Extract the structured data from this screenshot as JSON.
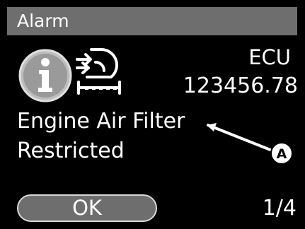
{
  "header": {
    "title": "Alarm"
  },
  "status": {
    "info_icon": "info-icon",
    "alarm_icon": "engine-air-filter-icon",
    "source_label": "ECU",
    "source_value": "123456.78"
  },
  "message": {
    "line1": "Engine Air Filter",
    "line2": "Restricted"
  },
  "annotation": {
    "callout_label": "A"
  },
  "footer": {
    "ok_label": "OK",
    "page_indicator": "1/4"
  },
  "colors": {
    "background": "#000000",
    "titlebar": "#6e6e6e",
    "button": "#6e6e6e",
    "text": "#ffffff"
  }
}
